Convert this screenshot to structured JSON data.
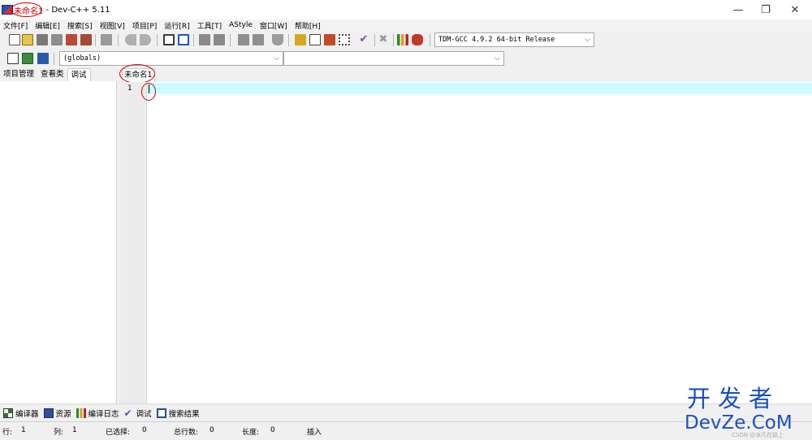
{
  "window": {
    "title_doc": "未命名1",
    "title_rest": " - Dev-C++ 5.11",
    "controls": {
      "minimize": "—",
      "maximize": "❐",
      "close": "✕"
    }
  },
  "menu": [
    "文件[F]",
    "编辑[E]",
    "搜索[S]",
    "视图[V]",
    "项目[P]",
    "运行[R]",
    "工具[T]",
    "AStyle",
    "窗口[W]",
    "帮助[H]"
  ],
  "toolbar": {
    "compiler_select": "TDM-GCC 4.9.2 64-bit Release"
  },
  "classbar": {
    "scope_select": "(globals)",
    "member_select": ""
  },
  "left_panel": {
    "tabs": [
      "项目管理",
      "查看类",
      "调试"
    ],
    "active_tab": "调试"
  },
  "editor": {
    "tab_label": "未命名1",
    "line_numbers": [
      "1"
    ],
    "current_line_color": "#ccfcff"
  },
  "bottom_tabs": [
    "编译器",
    "资源",
    "编译日志",
    "调试",
    "搜索结果"
  ],
  "status": {
    "row_label": "行:",
    "row_value": "1",
    "col_label": "列:",
    "col_value": "1",
    "sel_label": "已选择:",
    "sel_value": "0",
    "total_label": "总行数:",
    "total_value": "0",
    "len_label": "长度:",
    "len_value": "0",
    "mode": "插入"
  },
  "watermark": {
    "top": "开发者",
    "bottom": "DevZe.CoM",
    "small": "CSDN @冰凡在路上"
  },
  "colors": {
    "annotation": "#d40000",
    "watermark": "#1b4fbf",
    "current_line": "#ccfcff"
  }
}
